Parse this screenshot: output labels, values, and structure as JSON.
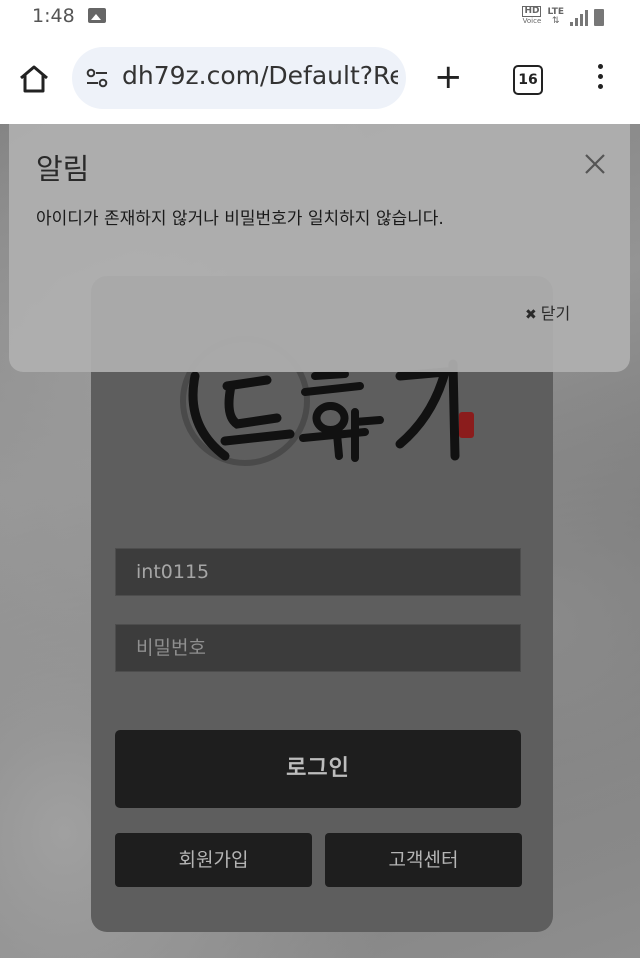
{
  "status_bar": {
    "time": "1:48",
    "hd_label": "HD",
    "voice_label": "Voice",
    "lte_label": "LTE",
    "icons": [
      "image-icon",
      "hd-voice-icon",
      "lte-icon",
      "signal-icon",
      "battery-icon"
    ]
  },
  "browser": {
    "url": "dh79z.com/Default?Re",
    "tab_count": "16",
    "icons": [
      "home-icon",
      "site-settings-icon",
      "new-tab-icon",
      "tab-switcher-icon",
      "overflow-menu-icon"
    ]
  },
  "modal": {
    "title": "알림",
    "message": "아이디가 존재하지 않거나 비밀번호가 일치하지 않습니다.",
    "close_label": "닫기"
  },
  "login": {
    "logo_alt": "도화지",
    "id_value": "int0115",
    "password_placeholder": "비밀번호",
    "login_label": "로그인",
    "join_label": "회원가입",
    "support_label": "고객센터"
  }
}
